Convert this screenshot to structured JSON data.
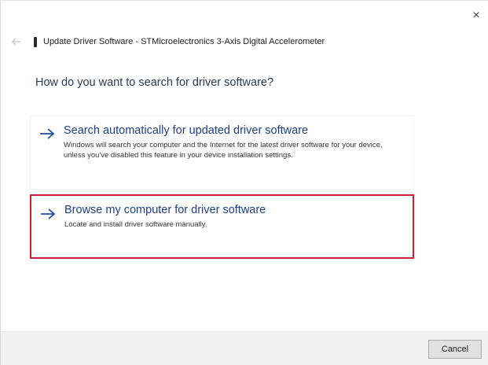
{
  "window": {
    "close_glyph": "×",
    "title": "Update Driver Software - STMicroelectronics 3-Axis Digital Accelerometer"
  },
  "main": {
    "heading": "How do you want to search for driver software?",
    "options": [
      {
        "title": "Search automatically for updated driver software",
        "description": "Windows will search your computer and the Internet for the latest driver software for your device, unless you've disabled this feature in your device installation settings.",
        "icon": "arrow-right-icon"
      },
      {
        "title": "Browse my computer for driver software",
        "description": "Locate and install driver software manually.",
        "icon": "arrow-right-icon",
        "highlighted": true,
        "highlight_color": "#cc2334"
      }
    ]
  },
  "footer": {
    "cancel_label": "Cancel"
  },
  "colors": {
    "option_title": "#1c3f86",
    "heading": "#2b3a55",
    "arrow": "#1c4f9c",
    "footer_bg": "#f0f0f0"
  }
}
